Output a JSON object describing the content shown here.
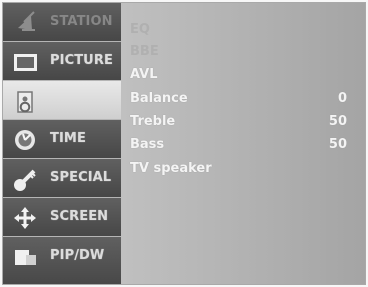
{
  "sidebar": {
    "items": [
      {
        "label": "STATION",
        "icon": "satellite-dish-icon"
      },
      {
        "label": "PICTURE",
        "icon": "tv-screen-icon"
      },
      {
        "label": "",
        "icon": "speaker-icon",
        "active": true
      },
      {
        "label": "TIME",
        "icon": "clock-icon"
      },
      {
        "label": "SPECIAL",
        "icon": "key-icon"
      },
      {
        "label": "SCREEN",
        "icon": "move-arrows-icon"
      },
      {
        "label": "PIP/DW",
        "icon": "pip-window-icon"
      }
    ]
  },
  "audio": {
    "rows": [
      {
        "label": "EQ",
        "value": "",
        "dim": true
      },
      {
        "label": "BBE",
        "value": "",
        "dim": true
      },
      {
        "label": "AVL",
        "value": ""
      },
      {
        "label": "Balance",
        "value": "0"
      },
      {
        "label": "Treble",
        "value": "50"
      },
      {
        "label": "Bass",
        "value": "50"
      },
      {
        "label": "TV speaker",
        "value": ""
      }
    ]
  },
  "colors": {
    "sidebar_bg": "#555555",
    "selected_tab": "#dddddd",
    "panel_bg": "#b0b0b0",
    "text": "#f4f4f4",
    "disabled_text": "#b0b0b0"
  }
}
